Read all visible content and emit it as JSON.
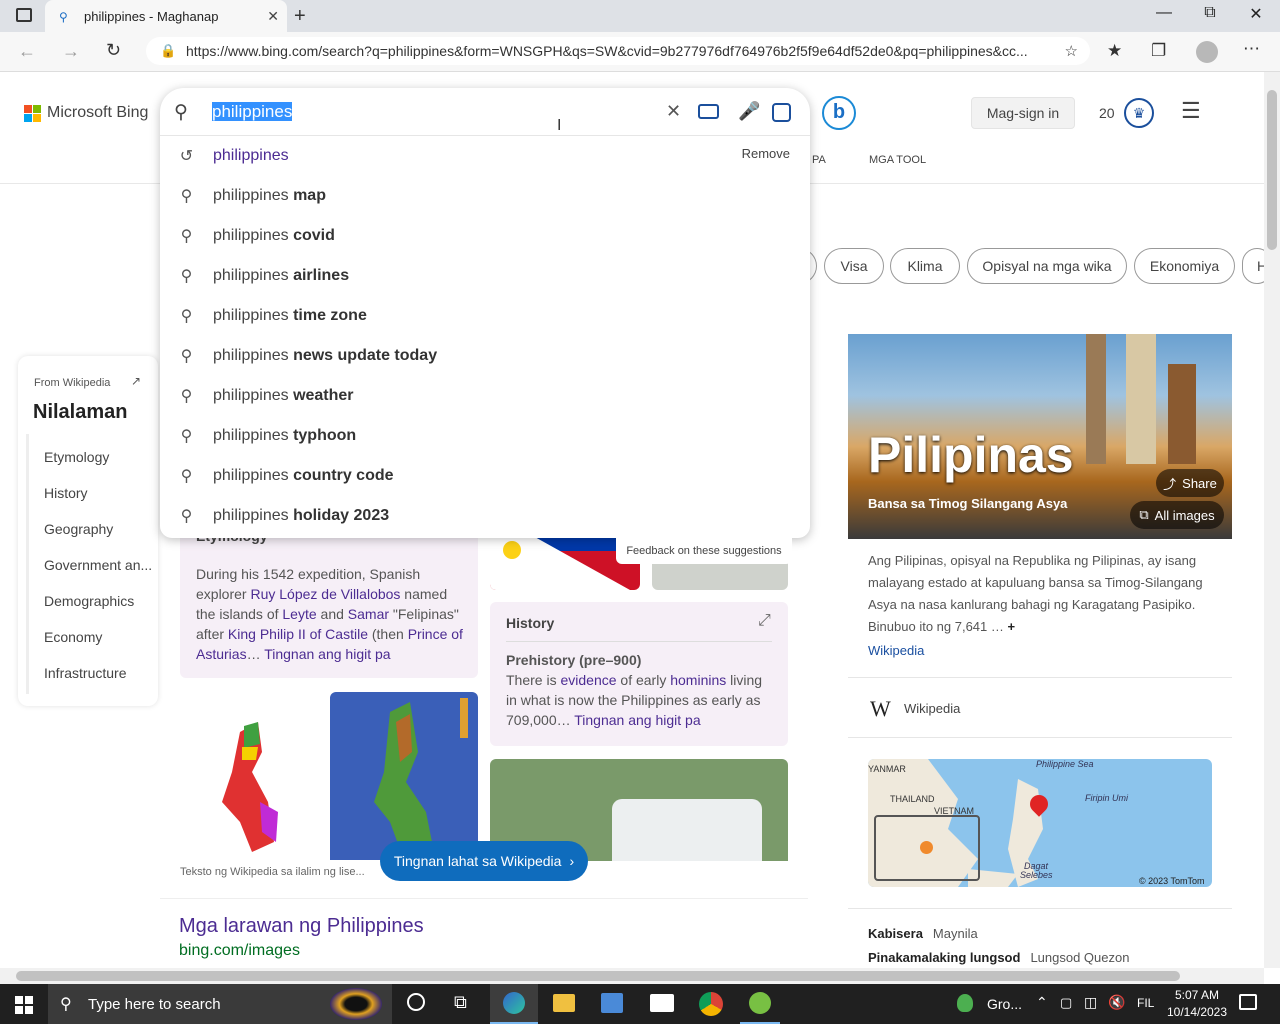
{
  "browser": {
    "tab_title": "philippines - Maghanap",
    "url": "https://www.bing.com/search?q=philippines&form=WNSGPH&qs=SW&cvid=9b277976df764976b2f5f9e64df52de0&pq=philippines&cc..."
  },
  "bing": {
    "logo_text": "Microsoft Bing",
    "signin": "Mag-sign in",
    "rewards_count": "20",
    "nav_partial": "PA",
    "tools": "MGA TOOL"
  },
  "search": {
    "query": "philippines",
    "remove_label": "Remove",
    "feedback": "Feedback on these suggestions",
    "suggestions": [
      {
        "prefix": "philippines",
        "bold": ""
      },
      {
        "prefix": "philippines ",
        "bold": "map"
      },
      {
        "prefix": "philippines ",
        "bold": "covid"
      },
      {
        "prefix": "philippines ",
        "bold": "airlines"
      },
      {
        "prefix": "philippines ",
        "bold": "time zone"
      },
      {
        "prefix": "philippines ",
        "bold": "news update today"
      },
      {
        "prefix": "philippines ",
        "bold": "weather"
      },
      {
        "prefix": "philippines ",
        "bold": "typhoon"
      },
      {
        "prefix": "philippines ",
        "bold": "country code"
      },
      {
        "prefix": "philippines ",
        "bold": "holiday 2023"
      }
    ]
  },
  "chips": [
    "Visa",
    "Klima",
    "Opisyal na mga wika",
    "Ekonomiya",
    "H"
  ],
  "toc": {
    "source": "From Wikipedia",
    "title": "Nilalaman",
    "items": [
      "Etymology",
      "History",
      "Geography",
      "Government an...",
      "Demographics",
      "Economy",
      "Infrastructure"
    ]
  },
  "etymology": {
    "heading": "Etymology",
    "t1": "During his 1542 expedition, Spanish explorer ",
    "l1": "Ruy López de Villalobos",
    "t2": " named the islands of ",
    "l2": "Leyte",
    "t3": " and ",
    "l3": "Samar",
    "t4": " \"Felipinas\" after ",
    "l4": "King Philip II of Castile",
    "t5": " (then ",
    "l5": "Prince of Asturias",
    "t6": "… ",
    "more": "Tingnan ang higit pa"
  },
  "history": {
    "heading": "History",
    "sub": "Prehistory (pre–900)",
    "t1": "There is ",
    "l1": "evidence",
    "t2": " of early ",
    "l2": "hominins",
    "t3": " living in what is now the Philippines as early as 709,000… ",
    "more": "Tingnan ang higit pa"
  },
  "wiki_footer": "Teksto ng Wikipedia sa ilalim ng lise...",
  "wiki_button": "Tingnan lahat sa Wikipedia",
  "images_result": {
    "title": "Mga larawan ng Philippines",
    "url": "bing.com/images"
  },
  "knowledge": {
    "title": "Pilipinas",
    "subtitle": "Bansa sa Timog Silangang Asya",
    "share": "Share",
    "all_images": "All images",
    "desc": "Ang Pilipinas, opisyal na Republika ng Pilipinas, ay isang malayang estado at kapuluang bansa sa Timog-Silangang Asya na nasa kanlurang bahagi ng Karagatang Pasipiko. Binubuo ito ng 7,641 …",
    "plus": "+",
    "source_link": "Wikipedia",
    "wiki_label": "Wikipedia",
    "map_labels": {
      "sea": "Philippine Sea",
      "myanmar": "YANMAR",
      "thailand": "THAILAND",
      "vietnam": "VIETNAM",
      "umi": "Firipin Umi",
      "dagat": "Dagat",
      "selebes": "Selebes",
      "copyright": "© 2023 TomTom"
    },
    "facts": [
      {
        "k": "Kabisera",
        "v": "Maynila"
      },
      {
        "k": "Pinakamalaking lungsod",
        "v": "Lungsod Quezon"
      }
    ]
  },
  "taskbar": {
    "search_placeholder": "Type here to search",
    "weather": "Gro...",
    "lang": "FIL",
    "time": "5:07 AM",
    "date": "10/14/2023"
  }
}
